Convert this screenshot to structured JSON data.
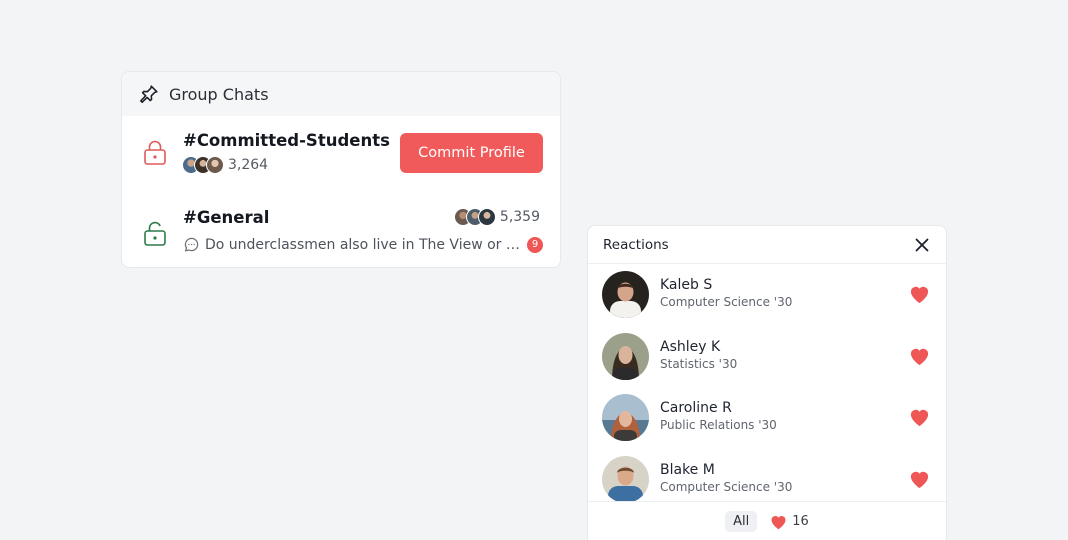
{
  "group_chats": {
    "title": "Group Chats",
    "icon": "pin-icon",
    "chats": [
      {
        "name": "#Committed-Students",
        "lock": "locked",
        "lock_color": "#e05a5a",
        "member_count": "3,264",
        "action_label": "Commit Profile"
      },
      {
        "name": "#General",
        "lock": "unlocked",
        "lock_color": "#2c7a4a",
        "member_count": "5,359",
        "last_message": "Do underclassmen also live in The View or is...",
        "unread": "9"
      }
    ]
  },
  "reactions": {
    "title": "Reactions",
    "people": [
      {
        "name": "Kaleb S",
        "subtitle": "Computer Science '30"
      },
      {
        "name": "Ashley K",
        "subtitle": "Statistics '30"
      },
      {
        "name": "Caroline R",
        "subtitle": "Public Relations '30"
      },
      {
        "name": "Blake M",
        "subtitle": "Computer Science '30"
      }
    ],
    "footer": {
      "all_label": "All",
      "heart_count": "16"
    }
  },
  "colors": {
    "accent": "#f15a5a",
    "heart": "#ef5656",
    "unlock": "#2c7a4a"
  }
}
